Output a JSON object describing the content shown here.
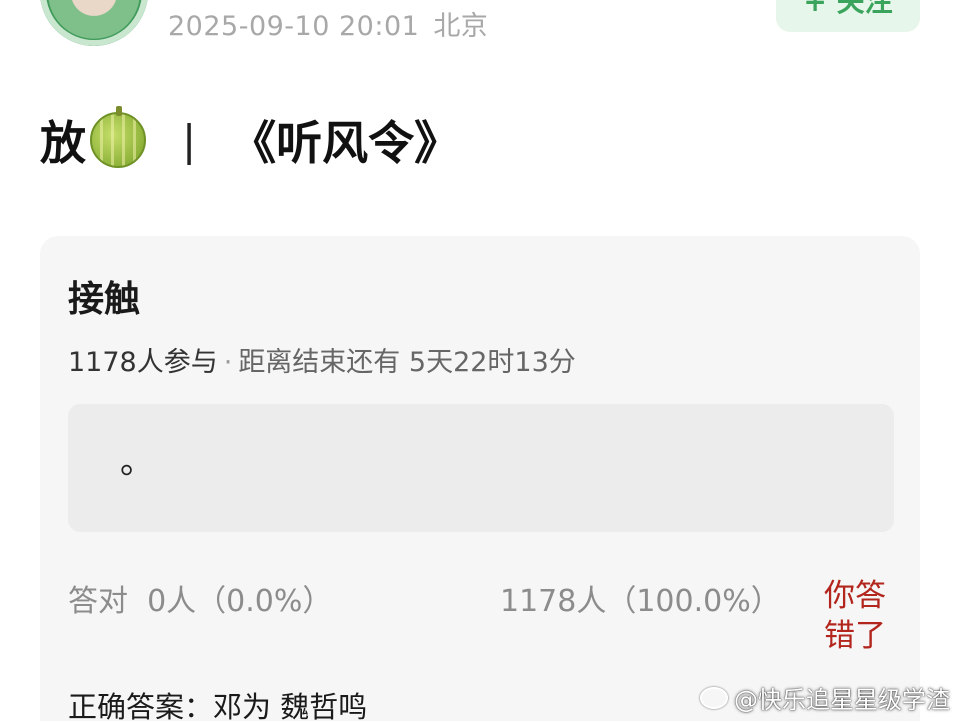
{
  "header": {
    "timestamp": "2025-09-10 20:01",
    "location": "北京",
    "follow_label": "+ 关注"
  },
  "post": {
    "title_prefix": "放",
    "title_emoji_icon": "melon-icon",
    "separator": "|",
    "title_suffix": "《听风令》"
  },
  "poll": {
    "title": "接触",
    "participants": "1178人参与",
    "dot": "·",
    "remaining": "距离结束还有 5天22时13分",
    "option_text": "。",
    "correct_label": "答对",
    "correct_stat": "0人（0.0%）",
    "wrong_stat": "1178人（100.0%）",
    "result_badge": "你答错了",
    "answer": "正确答案：邓为 魏哲鸣"
  },
  "watermark": {
    "text": "@快乐追星星级学渣",
    "icon": "weibo-icon"
  },
  "colors": {
    "accent_green": "#3aa45c",
    "wrong_red": "#b3261e",
    "meta_gray": "#a8a8a8"
  }
}
